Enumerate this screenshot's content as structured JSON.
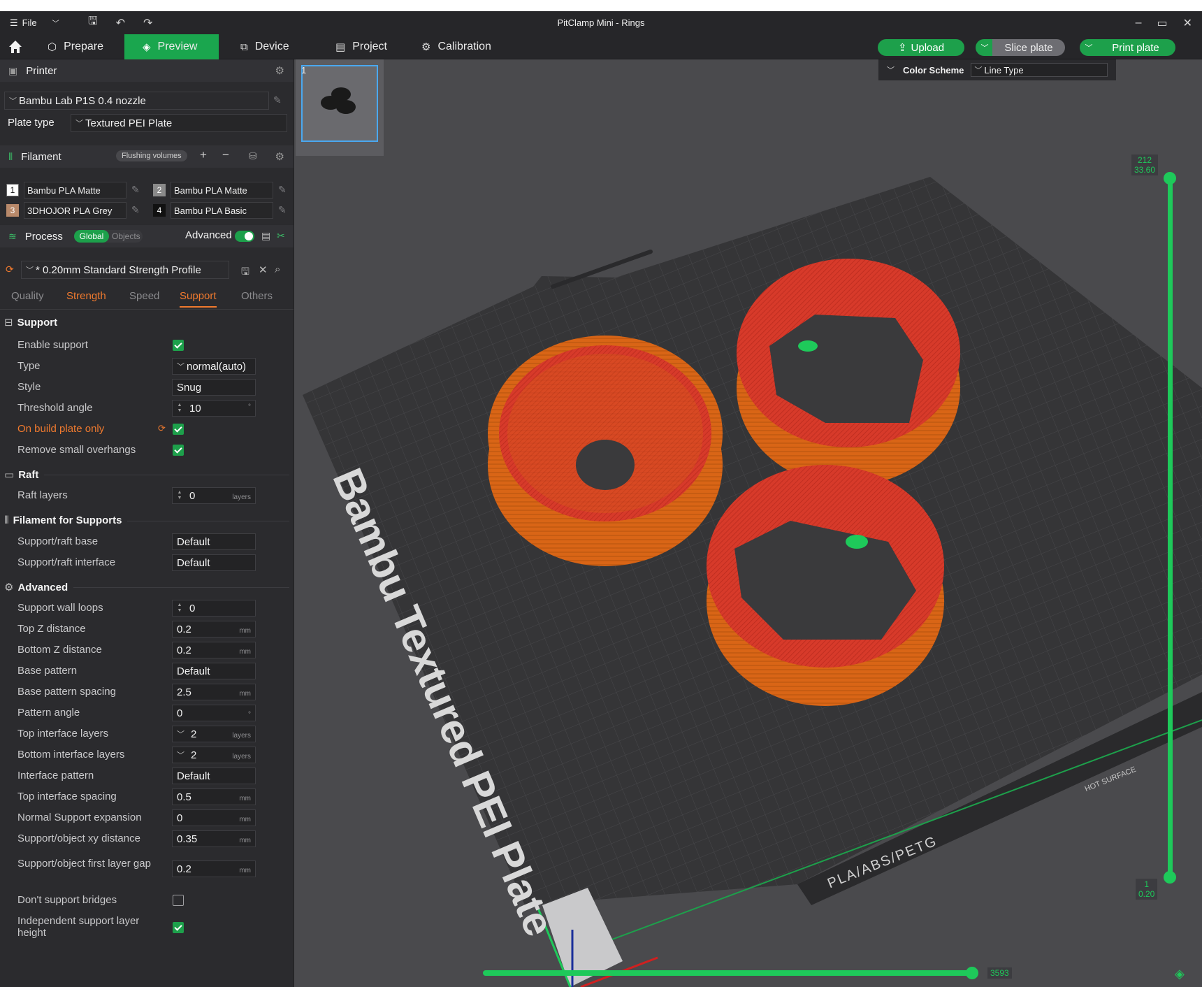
{
  "window": {
    "title": "PitClamp Mini - Rings",
    "file_menu": "File"
  },
  "toolbar": {
    "tabs": [
      "Prepare",
      "Preview",
      "Device",
      "Project",
      "Calibration"
    ],
    "upload": "Upload",
    "slice_plate": "Slice plate",
    "print_plate": "Print plate"
  },
  "printer": {
    "section": "Printer",
    "preset": "Bambu Lab P1S 0.4 nozzle",
    "plate_type_label": "Plate type",
    "plate_type": "Textured PEI Plate"
  },
  "filament": {
    "section": "Filament",
    "flushing": "Flushing volumes",
    "items": [
      {
        "num": "1",
        "name": "Bambu PLA Matte",
        "color": "#ffffff",
        "text": "#111111"
      },
      {
        "num": "2",
        "name": "Bambu PLA Matte",
        "color": "#8a8a8a",
        "text": "#ffffff"
      },
      {
        "num": "3",
        "name": "3DHOJOR PLA Grey",
        "color": "#b8896a",
        "text": "#ffffff"
      },
      {
        "num": "4",
        "name": "Bambu PLA Basic",
        "color": "#111111",
        "text": "#ffffff"
      }
    ]
  },
  "process": {
    "section": "Process",
    "global": "Global",
    "objects": "Objects",
    "advanced": "Advanced",
    "profile": "* 0.20mm Standard Strength Profile",
    "tabs": [
      "Quality",
      "Strength",
      "Speed",
      "Support",
      "Others"
    ]
  },
  "support": {
    "group": "Support",
    "enable_support": "Enable support",
    "type_label": "Type",
    "type_value": "normal(auto)",
    "style_label": "Style",
    "style_value": "Snug",
    "threshold_label": "Threshold angle",
    "threshold_value": "10",
    "threshold_unit": "°",
    "build_plate_only": "On build plate only",
    "remove_small": "Remove small overhangs"
  },
  "raft": {
    "group": "Raft",
    "layers_label": "Raft layers",
    "layers_value": "0",
    "layers_unit": "layers"
  },
  "filament_supports": {
    "group": "Filament for Supports",
    "base_label": "Support/raft base",
    "base_value": "Default",
    "interface_label": "Support/raft interface",
    "interface_value": "Default"
  },
  "advanced": {
    "group": "Advanced",
    "rows": [
      {
        "label": "Support wall loops",
        "value": "0",
        "unit": "",
        "spin": true
      },
      {
        "label": "Top Z distance",
        "value": "0.2",
        "unit": "mm"
      },
      {
        "label": "Bottom Z distance",
        "value": "0.2",
        "unit": "mm"
      },
      {
        "label": "Base pattern",
        "value": "Default",
        "unit": ""
      },
      {
        "label": "Base pattern spacing",
        "value": "2.5",
        "unit": "mm"
      },
      {
        "label": "Pattern angle",
        "value": "0",
        "unit": "°"
      },
      {
        "label": "Top interface layers",
        "value": "2",
        "unit": "layers",
        "chev": true
      },
      {
        "label": "Bottom interface layers",
        "value": "2",
        "unit": "layers",
        "chev": true
      },
      {
        "label": "Interface pattern",
        "value": "Default",
        "unit": ""
      },
      {
        "label": "Top interface spacing",
        "value": "0.5",
        "unit": "mm"
      },
      {
        "label": "Normal Support expansion",
        "value": "0",
        "unit": "mm"
      },
      {
        "label": "Support/object xy distance",
        "value": "0.35",
        "unit": "mm"
      }
    ],
    "first_layer_gap_label": "Support/object first layer gap",
    "first_layer_gap_value": "0.2",
    "first_layer_gap_unit": "mm",
    "dont_support_bridges": "Don't support bridges",
    "independent_height": "Independent support layer height"
  },
  "viewport": {
    "plate_number": "1",
    "color_scheme_label": "Color Scheme",
    "color_scheme_value": "Line Type",
    "plate_text": "Bambu Textured PEI Plate",
    "plate_strip_text": "PLA/ABS/PETG",
    "hot_surface": "HOT SURFACE",
    "layer_top": "212",
    "layer_top_height": "33.60",
    "layer_bottom": "1",
    "layer_bottom_height": "0.20",
    "move_count": "3593"
  }
}
